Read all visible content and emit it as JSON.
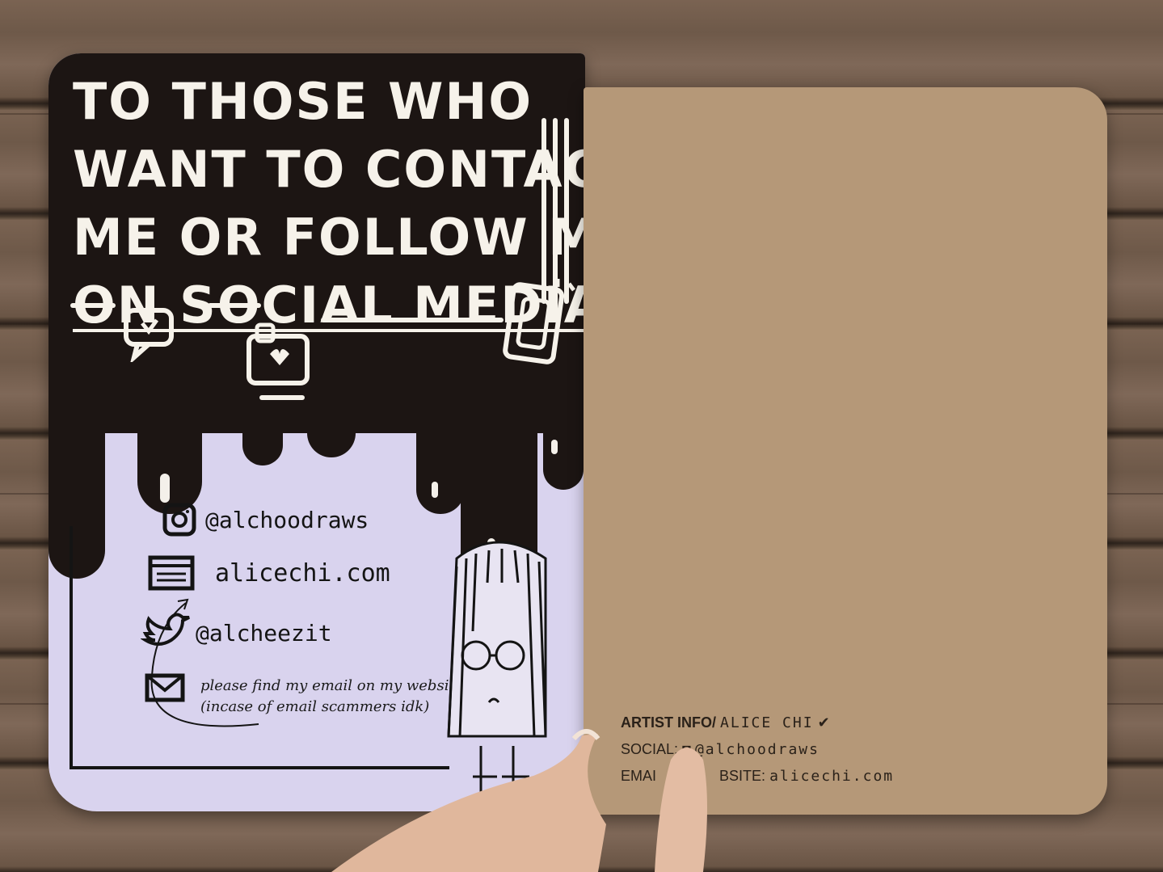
{
  "left_page": {
    "headline_lines": [
      "TO THOSE WHO",
      "WANT TO CONTACT",
      "ME OR FOLLOW ME",
      "ON SOCIAL MEDIA\""
    ],
    "contacts": {
      "instagram": "@alchoodraws",
      "website": "alicechi.com",
      "twitter": "@alcheezit",
      "email_note": "please find my email on my website (incase of email scammers idk)"
    },
    "colors": {
      "ink": "#1c1513",
      "paper": "#d9d3ee",
      "white_paint": "#f6f2ea"
    },
    "icons": [
      "heart-speech-bubble-icon",
      "heart-monitor-icon",
      "phone-icon",
      "instagram-icon",
      "browser-window-icon",
      "twitter-bird-icon",
      "envelope-icon"
    ]
  },
  "right_page": {
    "artist_info_label": "ARTIST INFO/",
    "artist_name": "ALICE CHI",
    "social_label": "SOCIAL:",
    "social_handle": "@alchoodraws",
    "email_label": "EMAI",
    "website_label": "BSITE:",
    "website_value": "alicechi.com",
    "colors": {
      "kraft": "#b59878"
    }
  }
}
